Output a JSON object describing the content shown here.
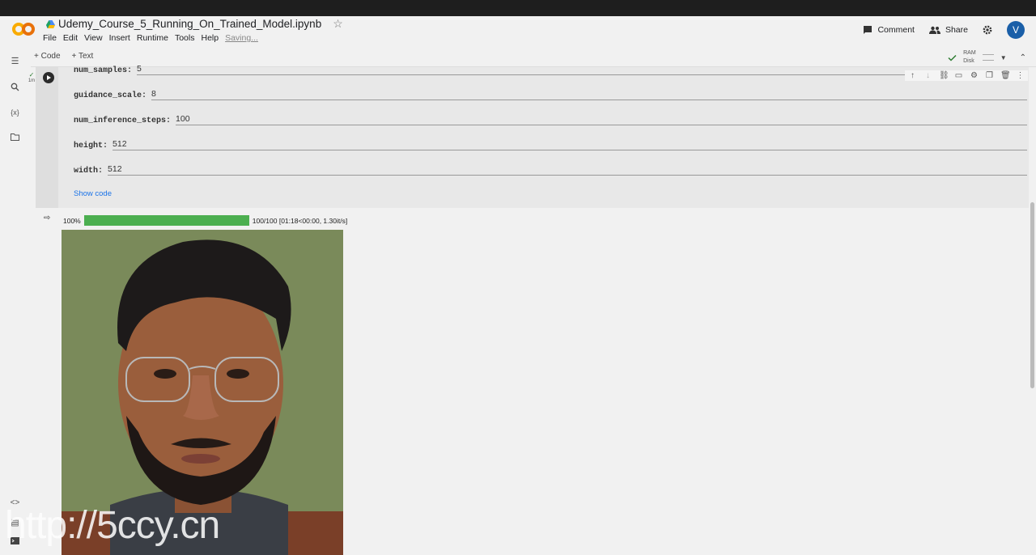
{
  "app": {
    "notebook_title": "Udemy_Course_5_Running_On_Trained_Model.ipynb",
    "menu": [
      "File",
      "Edit",
      "View",
      "Insert",
      "Runtime",
      "Tools",
      "Help"
    ],
    "saving_status": "Saving...",
    "comment_label": "Comment",
    "share_label": "Share",
    "avatar_letter": "V",
    "add_code_label": "+ Code",
    "add_text_label": "+ Text",
    "ram_label": "RAM",
    "disk_label": "Disk"
  },
  "cell": {
    "exec_time": "1m",
    "params": [
      {
        "label": "num_samples:",
        "value": "5"
      },
      {
        "label": "guidance_scale:",
        "value": "8"
      },
      {
        "label": "num_inference_steps:",
        "value": "100"
      },
      {
        "label": "height:",
        "value": "512"
      },
      {
        "label": "width:",
        "value": "512"
      }
    ],
    "show_code_label": "Show code"
  },
  "output": {
    "progress_percent_label": "100%",
    "progress_fraction": 1.0,
    "progress_text": "100/100 [01:18<00:00, 1.30it/s]"
  },
  "watermark": "http://5ccy.cn",
  "colors": {
    "progress_fill": "#4caf50",
    "link": "#1a73e8",
    "avatar": "#1a5fa8"
  }
}
